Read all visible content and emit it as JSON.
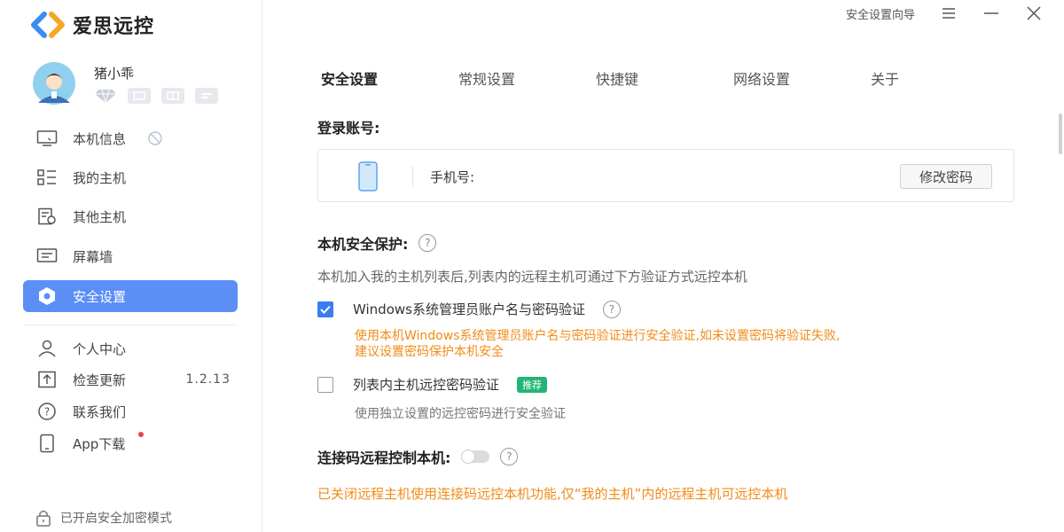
{
  "app": {
    "name": "爱思远控"
  },
  "profile": {
    "username": "猪小乖"
  },
  "sidebar": {
    "items": [
      {
        "label": "本机信息"
      },
      {
        "label": "我的主机"
      },
      {
        "label": "其他主机"
      },
      {
        "label": "屏幕墙"
      },
      {
        "label": "安全设置"
      },
      {
        "label": "个人中心"
      },
      {
        "label": "检查更新",
        "version": "1.2.13"
      },
      {
        "label": "联系我们"
      },
      {
        "label": "App下载"
      }
    ],
    "footer": "已开启安全加密模式"
  },
  "titlebar": {
    "wizard": "安全设置向导"
  },
  "tabs": [
    {
      "label": "安全设置"
    },
    {
      "label": "常规设置"
    },
    {
      "label": "快捷键"
    },
    {
      "label": "网络设置"
    },
    {
      "label": "关于"
    }
  ],
  "security": {
    "login_title": "登录账号:",
    "phone_label": "手机号:",
    "change_password": "修改密码",
    "protect_title": "本机安全保护:",
    "protect_desc": "本机加入我的主机列表后,列表内的远程主机可通过下方验证方式远控本机",
    "option1": {
      "label": "Windows系统管理员账户名与密码验证",
      "hint_line1": "使用本机Windows系统管理员账户名与密码验证进行安全验证,如未设置密码将验证失败,",
      "hint_line2": "建议设置密码保护本机安全"
    },
    "option2": {
      "label": "列表内主机远控密码验证",
      "tag": "推荐",
      "hint": "使用独立设置的远控密码进行安全验证"
    },
    "connect_title": "连接码远程控制本机:",
    "connect_note": "已关闭远程主机使用连接码远控本机功能,仅“我的主机”内的远程主机可远控本机"
  },
  "colors": {
    "accent": "#5b8ff6",
    "checkbox": "#3b7cf0",
    "warning": "#f08c1a",
    "tag": "#22b573"
  }
}
